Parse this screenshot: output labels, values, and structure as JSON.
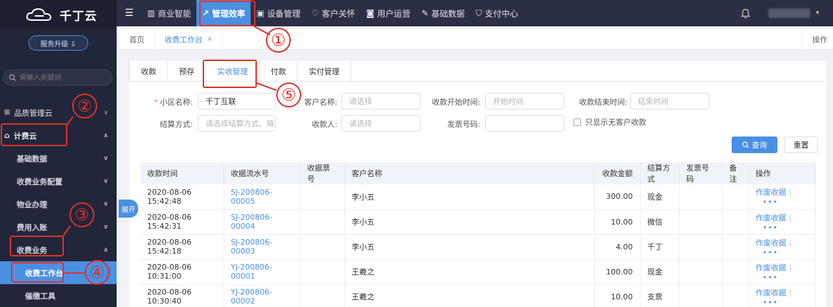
{
  "brand": {
    "name": "千丁云",
    "upgrade": "服务升级 ⇩"
  },
  "sidebar": {
    "search_placeholder": "请输入关键词",
    "items": [
      {
        "label": "品质管理云",
        "chev": "∨"
      },
      {
        "label": "计费云",
        "chev": "∧"
      },
      {
        "label": "基础数据",
        "chev": "∨"
      },
      {
        "label": "收费业务配置",
        "chev": "∨"
      },
      {
        "label": "物业办理",
        "chev": "∨"
      },
      {
        "label": "费用入账",
        "chev": "∨"
      },
      {
        "label": "收费业务",
        "chev": "∧"
      },
      {
        "label": "收费工作台",
        "chev": ""
      },
      {
        "label": "催缴工具",
        "chev": ""
      }
    ],
    "expand": "展开"
  },
  "topnav": {
    "items": [
      "商业智能",
      "管理效率",
      "设备管理",
      "客户关怀",
      "用户运营",
      "基础数据",
      "支付中心"
    ]
  },
  "tabsbar": {
    "home": "首页",
    "current": "收费工作台",
    "close": "×",
    "ops": "操作"
  },
  "subtabs": [
    "收款",
    "预存",
    "实收管理",
    "付款",
    "实付管理"
  ],
  "form": {
    "community_label": "小区名称:",
    "community_value": "千丁互联",
    "customer_label": "客户名称:",
    "customer_placeholder": "请选择",
    "start_label": "收款开始时间:",
    "start_placeholder": "开始时间",
    "end_label": "收款结束时间:",
    "end_placeholder": "结束时间",
    "method_label": "结算方式:",
    "method_placeholder": "请选择结算方式、输",
    "payee_label": "收款人:",
    "payee_placeholder": "请选择",
    "invoice_label": "发票号码:",
    "checkbox_label": "只显示无客户收款",
    "query": "查询",
    "reset": "重置"
  },
  "table": {
    "headers": [
      "收款时间",
      "收据流水号",
      "收据票号",
      "客户名称",
      "收款金额",
      "结算方式",
      "发票号码",
      "备注",
      "操作"
    ],
    "rows": [
      {
        "time": "2020-08-06 15:42:48",
        "serial": "SJ-200806-00005",
        "ticket": "",
        "customer": "李小五",
        "amount": "300.00",
        "method": "现金",
        "invoice": "",
        "note": "",
        "op": "作废收据"
      },
      {
        "time": "2020-08-06 15:42:31",
        "serial": "SJ-200806-00004",
        "ticket": "",
        "customer": "李小五",
        "amount": "10.00",
        "method": "微信",
        "invoice": "",
        "note": "",
        "op": "作废收据"
      },
      {
        "time": "2020-08-06 15:42:18",
        "serial": "SJ-200806-00003",
        "ticket": "",
        "customer": "李小五",
        "amount": "4.00",
        "method": "千丁",
        "invoice": "",
        "note": "",
        "op": "作废收据"
      },
      {
        "time": "2020-08-06 10:31:00",
        "serial": "YJ-200806-00001",
        "ticket": "",
        "customer": "王羲之",
        "amount": "100.00",
        "method": "现金",
        "invoice": "",
        "note": "",
        "op": "作废收据"
      },
      {
        "time": "2020-08-06 10:30:40",
        "serial": "YJ-200806-00002",
        "ticket": "",
        "customer": "王羲之",
        "amount": "10.00",
        "method": "支票",
        "invoice": "",
        "note": "",
        "op": "作废收据"
      }
    ],
    "more": "•••"
  },
  "annotations": [
    "①",
    "②",
    "③",
    "④",
    "⑤"
  ],
  "colors": {
    "accent": "#4a90e2",
    "annotation": "#e0302b",
    "sidebar": "#22263a",
    "topnav": "#2b2f45"
  }
}
